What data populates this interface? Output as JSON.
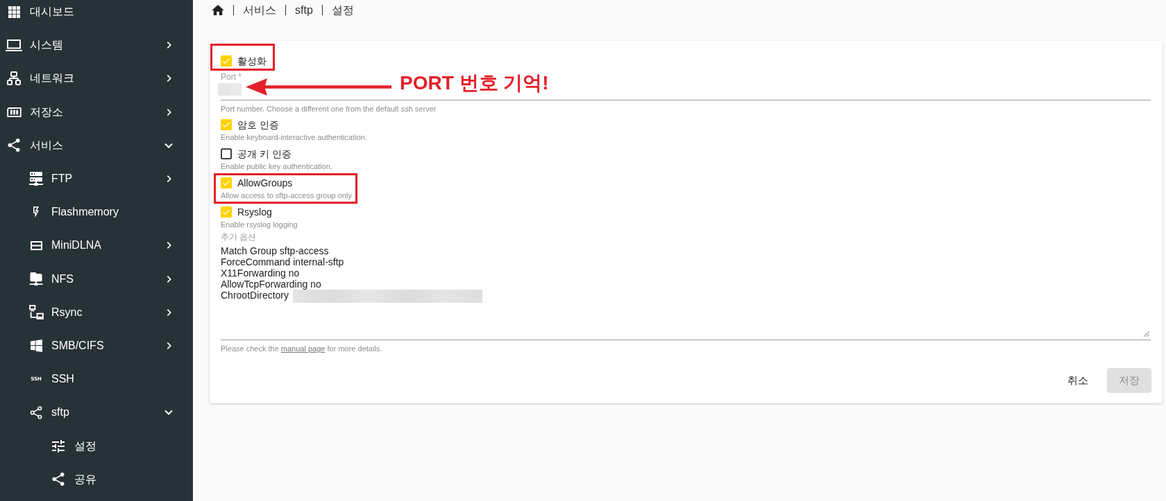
{
  "sidebar": {
    "items": [
      {
        "kind": "link",
        "label": "대시보드"
      },
      {
        "kind": "group",
        "label": "시스템",
        "expanded": false
      },
      {
        "kind": "group",
        "label": "네트워크",
        "expanded": false
      },
      {
        "kind": "group",
        "label": "저장소",
        "expanded": false
      },
      {
        "kind": "group",
        "label": "서비스",
        "expanded": true,
        "children": [
          {
            "kind": "group",
            "label": "FTP",
            "expanded": false
          },
          {
            "kind": "link",
            "label": "Flashmemory"
          },
          {
            "kind": "group",
            "label": "MiniDLNA",
            "expanded": false
          },
          {
            "kind": "group",
            "label": "NFS",
            "expanded": false
          },
          {
            "kind": "group",
            "label": "Rsync",
            "expanded": false
          },
          {
            "kind": "group",
            "label": "SMB/CIFS",
            "expanded": false
          },
          {
            "kind": "link",
            "label": "SSH",
            "icon_text": "SSH"
          },
          {
            "kind": "group",
            "label": "sftp",
            "expanded": true,
            "children": [
              {
                "kind": "link",
                "label": "설정"
              },
              {
                "kind": "link",
                "label": "공유"
              }
            ]
          }
        ]
      }
    ]
  },
  "breadcrumb": {
    "items": [
      "서비스",
      "sftp",
      "설정"
    ]
  },
  "form": {
    "enable": {
      "label": "활성화",
      "checked": true,
      "highlighted": true
    },
    "port": {
      "label": "Port *",
      "redacted": true,
      "hint": "Port number. Choose a different one from the default ssh server",
      "callout": "PORT 번호 기억!"
    },
    "options": [
      {
        "label": "암호 인증",
        "hint": "Enable keyboard-interactive authentication.",
        "checked": true,
        "highlighted": false
      },
      {
        "label": "공개 키 인증",
        "hint": "Enable public key authentication.",
        "checked": false,
        "highlighted": false
      },
      {
        "label": "AllowGroups",
        "hint": "Allow access to sftp-access group only",
        "checked": true,
        "highlighted": true
      },
      {
        "label": "Rsyslog",
        "hint": "Enable rsyslog logging",
        "checked": true,
        "highlighted": false
      }
    ],
    "extra_options": {
      "label": "추가 옵션",
      "lines": [
        {
          "text": "Match Group sftp-access",
          "redacted": false
        },
        {
          "text": "ForceCommand internal-sftp",
          "redacted": false
        },
        {
          "text": "X11Forwarding no",
          "redacted": false
        },
        {
          "text": "AllowTcpForwarding no",
          "redacted": false
        },
        {
          "text": "ChrootDirectory",
          "redacted": true
        }
      ],
      "hint": {
        "before": "Please check the ",
        "link": "manual page",
        "after": " for more details."
      }
    },
    "buttons": [
      {
        "label": "취소",
        "kind": "text",
        "disabled": false
      },
      {
        "label": "저장",
        "kind": "filled",
        "disabled": true
      }
    ]
  }
}
